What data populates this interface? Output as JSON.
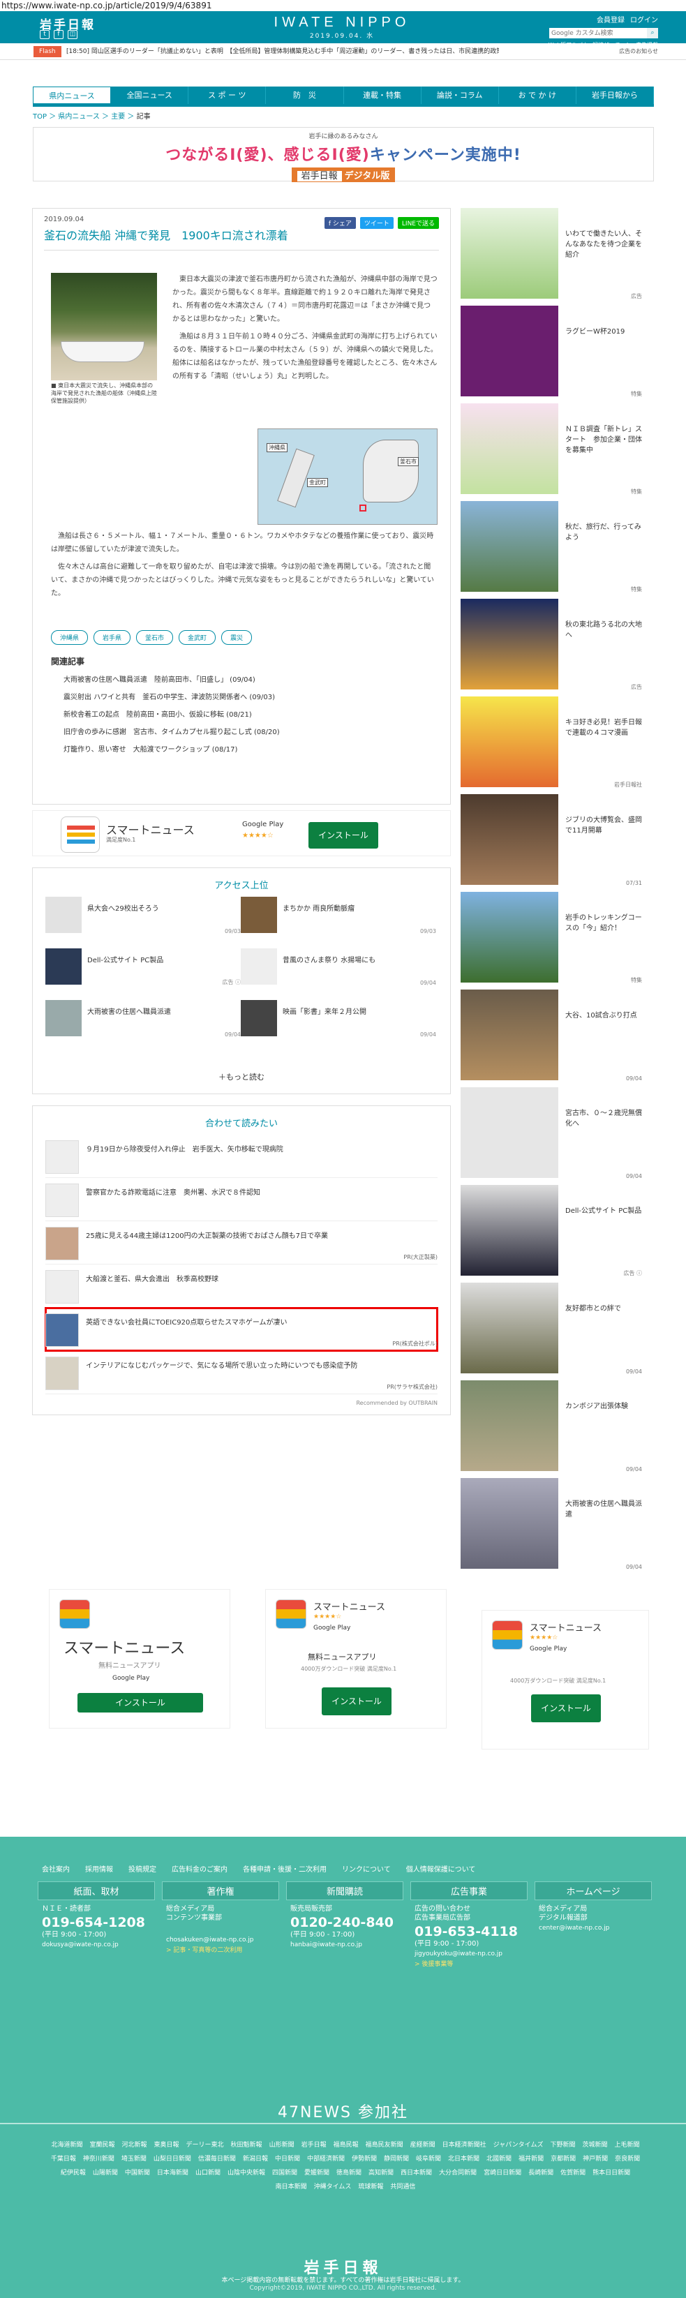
{
  "url": "https://www.iwate-np.co.jp/article/2019/9/4/63891",
  "header": {
    "logo": "岩手日報",
    "brand": "IWATE NIPPO",
    "date": "2019.09.04. 水",
    "links": [
      "会員登録",
      "ログイン"
    ],
    "search_placeholder": "Google カスタム検索",
    "sub": [
      "Web版アルバム",
      "記憶ザーチャン",
      "広告掲載"
    ]
  },
  "flash": {
    "label": "Flash",
    "text": "[18:50] 岡山区選手のリーダー「抗議止めない」と表明　【全低所局】管理体制構築見込む手中「周辺運動」のリーダー、書き残ったは日、市民連携的政策要は連合「自由ー",
    "right": "広告のお知らせ"
  },
  "nav": [
    "県内ニュース",
    "全国ニュース",
    "ス ポ ー ツ",
    "防　災",
    "連載・特集",
    "論説・コラム",
    "お で か け",
    "岩手日報から"
  ],
  "breadcrumb": [
    "TOP",
    "県内ニュース",
    "主要",
    "記事"
  ],
  "banner": {
    "small": "岩手に縁のあるみなさん",
    "main_pre": "つながるI(愛)、感じるI(愛)",
    "main_post": "キャンペーン実施中!",
    "badge_logo": "岩手日報",
    "badge": "デジタル版"
  },
  "article": {
    "date": "2019.09.04",
    "share": [
      "f シェア",
      "ツイート",
      "LINEで送る"
    ],
    "title": "釜石の流失船 沖縄で発見　1900キロ流され漂着",
    "caption": "■ 東日本大震災で流失し、沖縄県本部の海岸で発見された漁船の船体（沖縄県上陸保管施設提供）",
    "p1": "東日本大震災の津波で釜石市唐丹町から流された漁船が、沖縄県中部の海岸で見つかった。震災から間もなく８年半。直線距離で約１９２０キロ離れた海岸で発見され、所有者の佐々木清次さん（７４）＝同市唐丹町花露辺＝は「まさか沖縄で見つかるとは思わなかった」と驚いた。",
    "p2": "漁船は８月３１日午前１０時４０分ごろ、沖縄県金武町の海岸に打ち上げられているのを、隣接するトロール業の中村太さん（５９）が、沖縄県への鎮火で発見した。船体には船名はなかったが、残っていた漁船登録番号を確認したところ、佐々木さんの所有する「清昭（せいしょう）丸」と判明した。",
    "p3": "漁船は長さ６・５メートル、幅１・７メートル、重量０・６トン。ワカメやホタテなどの養殖作業に使っており、震災時は岸壁に係留していたが津波で流失した。",
    "p4": "佐々木さんは高台に避難して一命を取り留めたが、自宅は津波で損壊。今は別の船で漁を再開している。「流されたと聞いて、まさかの沖縄で見つかったとはびっくりした。沖縄で元気な姿をもっと見ることができたらうれしいな」と驚いていた。",
    "map": {
      "labels": [
        "沖縄県",
        "金武町",
        "釜石市"
      ]
    },
    "tags": [
      "沖縄県",
      "岩手県",
      "釜石市",
      "金武町",
      "震災"
    ],
    "related_title": "関連記事",
    "related": [
      "大雨被害の住居へ職員派遣　陸前高田市、「旧盛し」 (09/04)",
      "震災射出 ハワイと共有　釜石の中学生、津波防災関係者へ (09/03)",
      "新校舎着工の起点　陸前高田・高田小、仮設に移転 (08/21)",
      "旧庁舎の歩みに感謝　宮古市、タイムカプセル掘り起こし式 (08/20)",
      "灯籠作り、思い寄せ　大船渡でワークショップ (08/17)"
    ]
  },
  "ad1": {
    "name": "スマートニュース",
    "sub": "満足度No.1",
    "gp": "Google Play",
    "stars": "★★★★☆",
    "install": "インストール"
  },
  "access": {
    "title": "アクセス上位",
    "items": [
      {
        "title": "県大会へ29校出そろう",
        "date": "09/03"
      },
      {
        "title": "まちかか 雨良所動脈瘤",
        "date": "09/03"
      },
      {
        "title": "Dell-公式サイト PC製品",
        "date": "広告 ⓘ"
      },
      {
        "title": "昔風のさんま祭り 水揚場にも",
        "date": "09/04"
      },
      {
        "title": "大雨被害の住居へ職員派遣",
        "date": "09/04"
      },
      {
        "title": "映画「影書」来年２月公開",
        "date": "09/04"
      }
    ],
    "more": "＋もっと読む"
  },
  "read": {
    "title": "合わせて読みたい",
    "items": [
      {
        "title": "９月19日から除夜受付入れ停止　岩手医大、矢巾移転で現病院",
        "pr": ""
      },
      {
        "title": "警察官かたる詐欺電話に注意　奥州署、水沢で８件認知",
        "pr": ""
      },
      {
        "title": "25歳に見える44歳主婦は1200円の大正製薬の技術でおばさん顔も7日で卒業",
        "pr": "PR(大正製薬)"
      },
      {
        "title": "大船渡と釜石、県大会進出　秋季高校野球",
        "pr": ""
      },
      {
        "title": "英語できない会社員にTOEIC920点取らせたスマホゲームが凄い",
        "pr": "PR(株式会社ポル)"
      },
      {
        "title": "インテリアになじむパッケージで、気になる場所で思い立った時にいつでも感染症予防",
        "pr": "PR(サラヤ株式会社)"
      }
    ],
    "rec": "Recommended by OUTBRAIN"
  },
  "ads2": {
    "a": {
      "name": "スマートニュース",
      "sub": "無料ニュースアプリ",
      "gp": "Google Play",
      "install": "インストール"
    },
    "b": {
      "name": "スマートニュース",
      "stars": "★★★★☆",
      "sub": "無料ニュースアプリ",
      "sm": "4000万ダウンロード突破 満足度No.1",
      "gp": "Google Play",
      "install": "インストール"
    },
    "c": {
      "name": "スマートニュース",
      "stars": "★★★★☆",
      "gp": "Google Play",
      "sm": "4000万ダウンロード突破 満足度No.1",
      "install": "インストール"
    }
  },
  "side": [
    {
      "title": "いわてで働きたい人、そんなあなたを待つ企業を紹介",
      "date": "広告"
    },
    {
      "title": "ラグビーW杯2019",
      "date": "特集"
    },
    {
      "title": "ＮＩＢ調査「新トレ」スタート　参加企業・団体を募集中",
      "date": "特集"
    },
    {
      "title": "秋だ、旅行だ、行ってみよう",
      "date": "特集"
    },
    {
      "title": "秋の東北路うる北の大地へ",
      "date": "広告"
    },
    {
      "title": "キヨ好き必見！岩手日報で連載の４コマ漫画",
      "date": "岩手日報社"
    },
    {
      "title": "ジブリの大博覧会、盛岡で11月開幕",
      "date": "07/31"
    },
    {
      "title": "岩手のトレッキングコースの「今」紹介！",
      "date": "特集"
    },
    {
      "title": "大谷、10試合ぶり打点",
      "date": "09/04"
    },
    {
      "title": "宮古市、０～２歳児無償化へ",
      "date": "09/04"
    },
    {
      "title": "Dell-公式サイト PC製品",
      "date": "広告 ⓘ"
    },
    {
      "title": "友好都市との絆で",
      "date": "09/04"
    },
    {
      "title": "カンボジア出張体験",
      "date": "09/04"
    },
    {
      "title": "大雨被害の住居へ職員派遣",
      "date": "09/04"
    }
  ],
  "footer": {
    "nav": [
      "会社案内",
      "採用情報",
      "投稿規定",
      "広告料金のご案内",
      "各種申請・後援・二次利用",
      "リンクについて",
      "個人情報保護について"
    ],
    "cols": [
      {
        "head": "紙面、取材",
        "sub": "ＮＩＥ・読者部",
        "tel": "019-654-1208",
        "hours": "(平日 9:00 - 17:00)",
        "email": "dokusya@iwate-np.co.jp",
        "link": ""
      },
      {
        "head": "著作権",
        "sub": "総合メディア局\nコンテンツ事業部",
        "tel": "",
        "hours": "",
        "email": "chosakuken@iwate-np.co.jp",
        "link": "> 記事・写真等の二次利用"
      },
      {
        "head": "新聞購読",
        "sub": "販売局販売部",
        "tel": "0120-240-840",
        "hours": "(平日 9:00 - 17:00)",
        "email": "hanbai@iwate-np.co.jp",
        "link": ""
      },
      {
        "head": "広告事業",
        "sub": "広告の問い合わせ\n広告事業局広告部",
        "tel": "019-653-4118",
        "hours": "(平日 9:00 - 17:00)",
        "email": "jigyoukyoku@iwate-np.co.jp",
        "link": "> 後援事業等"
      },
      {
        "head": "ホームページ",
        "sub": "総合メディア局\nデジタル報道部",
        "tel": "",
        "hours": "",
        "email": "center@iwate-np.co.jp",
        "link": ""
      }
    ],
    "f47": "47NEWS 参加社",
    "papers": [
      "北海道新聞",
      "室蘭民報",
      "河北新報",
      "東奥日報",
      "デーリー東北",
      "秋田魁新報",
      "山形新聞",
      "岩手日報",
      "福島民報",
      "福島民友新聞",
      "産経新聞",
      "日本経済新聞社",
      "ジャパンタイムズ",
      "下野新聞",
      "茨城新聞",
      "上毛新聞",
      "千葉日報",
      "神奈川新聞",
      "埼玉新聞",
      "山梨日日新聞",
      "信濃毎日新聞",
      "新潟日報",
      "中日新聞",
      "中部経済新聞",
      "伊勢新聞",
      "静岡新聞",
      "岐阜新聞",
      "北日本新聞",
      "北國新聞",
      "福井新聞",
      "京都新聞",
      "神戸新聞",
      "奈良新聞",
      "紀伊民報",
      "山陽新聞",
      "中国新聞",
      "日本海新聞",
      "山口新聞",
      "山陰中央新報",
      "四国新聞",
      "愛媛新聞",
      "徳島新聞",
      "高知新聞",
      "西日本新聞",
      "大分合同新聞",
      "宮崎日日新聞",
      "長崎新聞",
      "佐賀新聞",
      "熊本日日新聞",
      "南日本新聞",
      "沖縄タイムス",
      "琉球新報",
      "共同通信"
    ],
    "logo": "岩手日報",
    "note": "本ページ掲載内容の無断転載を禁じます。すべての著作権は岩手日報社に帰属します。",
    "copy": "Copyright©2019, IWATE NIPPO CO.,LTD. All rights reserved."
  }
}
